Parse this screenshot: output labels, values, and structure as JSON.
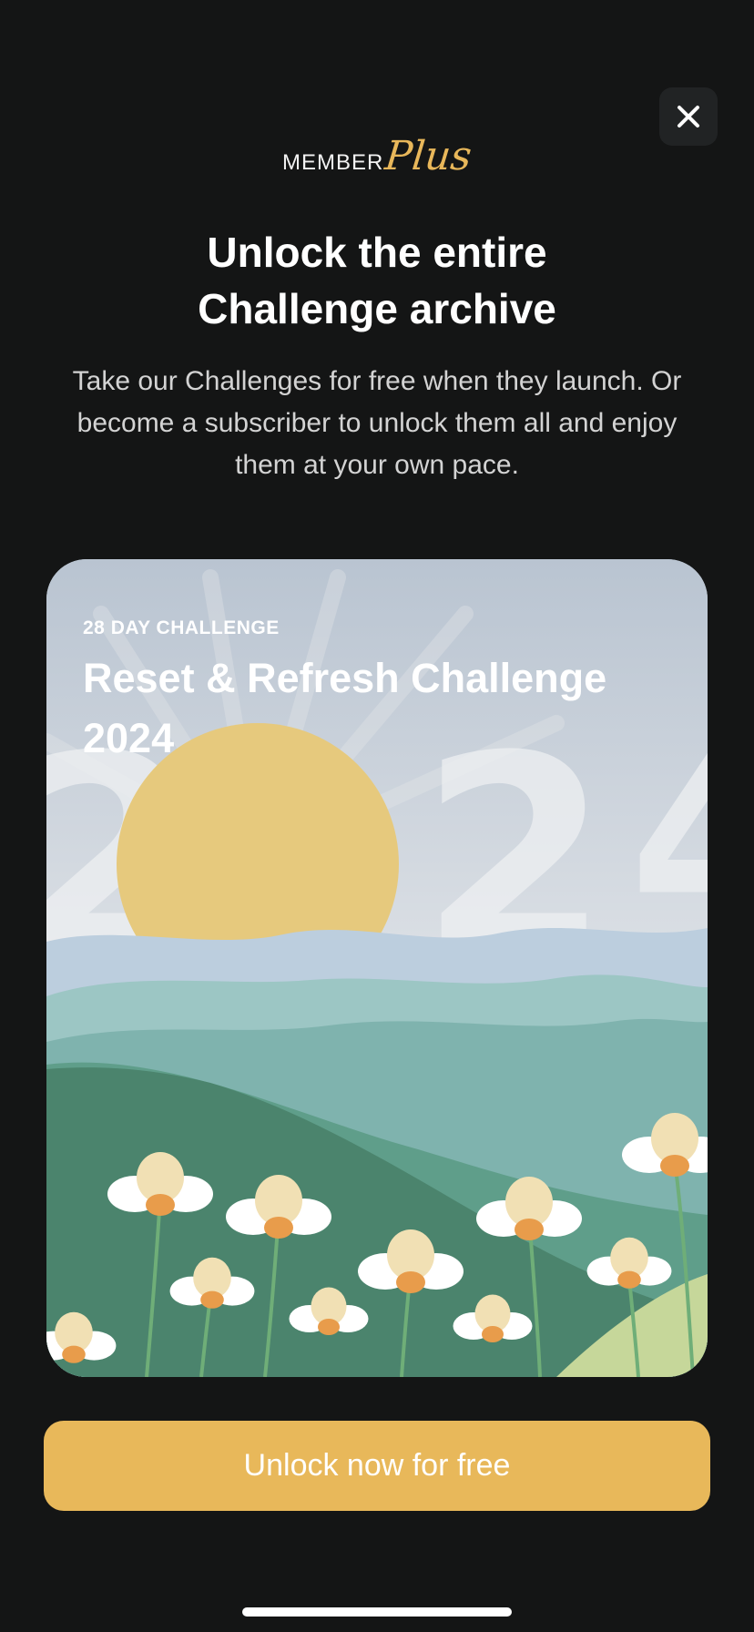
{
  "close_button": {
    "icon": "close-icon"
  },
  "brand": {
    "member_text": "MEMBER",
    "plus_text": "Plus",
    "accent_color": "#e8b75a"
  },
  "headline": {
    "line1": "Unlock the entire",
    "line2": "Challenge archive"
  },
  "subtext": "Take our Challenges for free when they launch. Or become a subscriber to unlock them all and enjoy them at your own pace.",
  "card": {
    "eyebrow": "28 DAY CHALLENGE",
    "title": "Reset & Refresh Challenge 2024",
    "image_description_icon": "sunrise-meadow-illustration"
  },
  "cta": {
    "label": "Unlock now for free",
    "color": "#e8b85a"
  },
  "colors": {
    "background": "#141515",
    "close_button_bg": "#212324"
  }
}
